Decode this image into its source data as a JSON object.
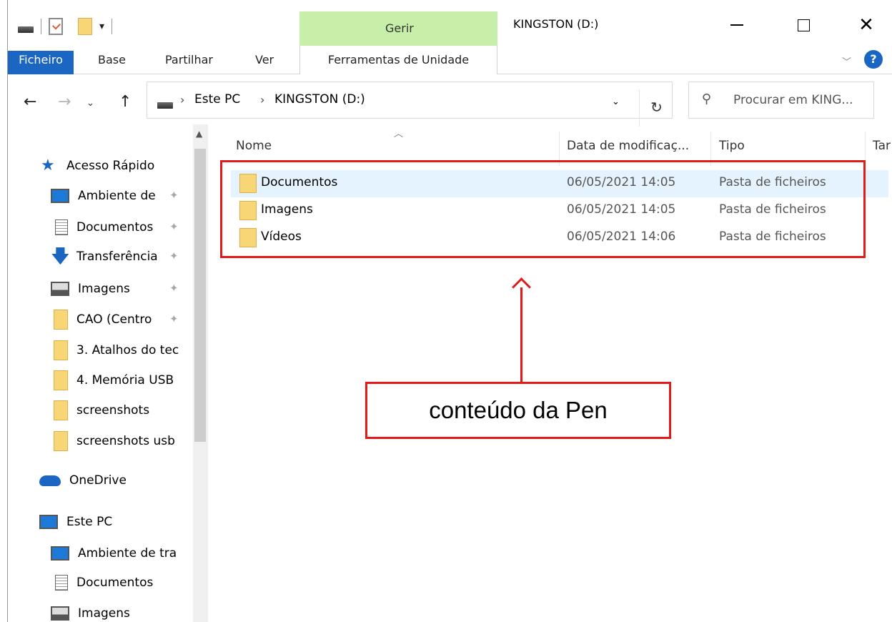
{
  "window": {
    "title": "KINGSTON (D:)"
  },
  "quick_access_toolbar": {
    "icons": [
      "drive-icon",
      "properties-icon",
      "new-folder-icon",
      "customize-dropdown-icon"
    ]
  },
  "contextual_tab_group": {
    "label": "Gerir",
    "color": "#c7efaa"
  },
  "ribbon": {
    "tabs": [
      "Ficheiro",
      "Base",
      "Partilhar",
      "Ver",
      "Ferramentas de Unidade"
    ],
    "active_accent": "#1a66c2"
  },
  "address_bar": {
    "breadcrumbs": [
      "Este PC",
      "KINGSTON (D:)"
    ]
  },
  "search": {
    "placeholder": "Procurar em KING..."
  },
  "nav_pane": {
    "quick_access": {
      "label": "Acesso Rápido"
    },
    "pinned": [
      {
        "label": "Ambiente de",
        "icon": "desktop-icon"
      },
      {
        "label": "Documentos",
        "icon": "documents-icon"
      },
      {
        "label": "Transferência",
        "icon": "downloads-icon"
      },
      {
        "label": "Imagens",
        "icon": "pictures-icon"
      },
      {
        "label": "CAO (Centro",
        "icon": "folder-icon"
      },
      {
        "label": "3. Atalhos do tec",
        "icon": "folder-icon"
      },
      {
        "label": "4. Memória USB",
        "icon": "folder-icon"
      },
      {
        "label": "screenshots",
        "icon": "folder-icon"
      },
      {
        "label": "screenshots usb",
        "icon": "folder-icon"
      }
    ],
    "onedrive": {
      "label": "OneDrive"
    },
    "this_pc": {
      "label": "Este PC",
      "children": [
        {
          "label": "Ambiente de tra",
          "icon": "desktop-icon"
        },
        {
          "label": "Documentos",
          "icon": "documents-icon"
        },
        {
          "label": "Imagens",
          "icon": "pictures-icon"
        }
      ]
    }
  },
  "file_list": {
    "columns": [
      "Nome",
      "Data de modificaç...",
      "Tipo",
      "Tar"
    ],
    "rows": [
      {
        "name": "Documentos",
        "date": "06/05/2021 14:05",
        "type": "Pasta de ficheiros",
        "selected": true
      },
      {
        "name": "Imagens",
        "date": "06/05/2021 14:05",
        "type": "Pasta de ficheiros",
        "selected": false
      },
      {
        "name": "Vídeos",
        "date": "06/05/2021 14:06",
        "type": "Pasta de ficheiros",
        "selected": false
      }
    ]
  },
  "annotation": {
    "callout_text": "conteúdo da Pen",
    "color": "#e21a1a"
  }
}
